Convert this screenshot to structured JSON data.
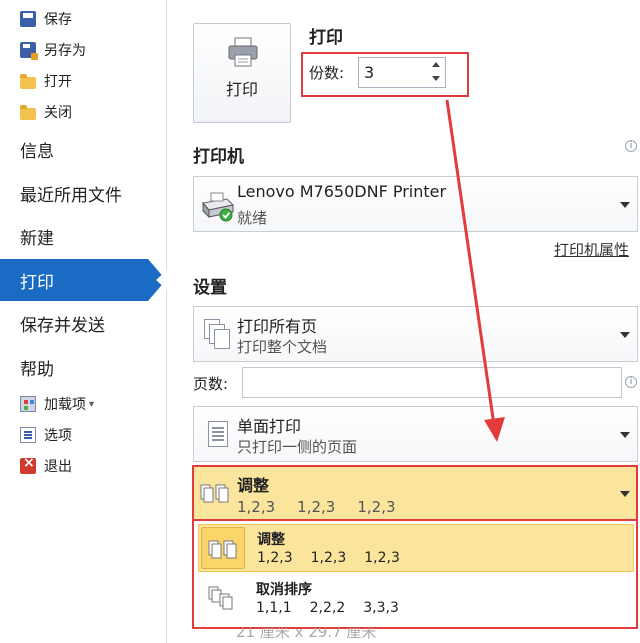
{
  "sidebar": {
    "items": [
      {
        "label": "保存",
        "icon": "save-icon"
      },
      {
        "label": "另存为",
        "icon": "save-as-icon"
      },
      {
        "label": "打开",
        "icon": "open-folder-icon"
      },
      {
        "label": "关闭",
        "icon": "close-folder-icon"
      },
      {
        "label": "信息"
      },
      {
        "label": "最近所用文件"
      },
      {
        "label": "新建"
      },
      {
        "label": "打印",
        "active": true
      },
      {
        "label": "保存并发送"
      },
      {
        "label": "帮助"
      },
      {
        "label": "加载项",
        "icon": "add-ins-icon",
        "suffix": "▾"
      },
      {
        "label": "选项",
        "icon": "options-icon"
      },
      {
        "label": "退出",
        "icon": "exit-icon"
      }
    ],
    "active_color": "#1a6bc4"
  },
  "print": {
    "heading": "打印",
    "button_label": "打印",
    "copies_label": "份数:",
    "copies_value": "3"
  },
  "printer": {
    "heading": "打印机",
    "name": "Lenovo M7650DNF Printer",
    "status": "就绪",
    "properties_link": "打印机属性"
  },
  "settings": {
    "heading": "设置",
    "range": {
      "title": "打印所有页",
      "subtitle": "打印整个文档"
    },
    "pages_label": "页数:",
    "pages_value": "",
    "sides": {
      "title": "单面打印",
      "subtitle": "只打印一侧的页面"
    },
    "collate": {
      "title": "调整",
      "sequence": [
        "1,2,3",
        "1,2,3",
        "1,2,3"
      ],
      "highlight_color": "#fbe49c",
      "options": [
        {
          "title": "调整",
          "sequence": [
            "1,2,3",
            "1,2,3",
            "1,2,3"
          ],
          "selected": true
        },
        {
          "title": "取消排序",
          "sequence": [
            "1,1,1",
            "2,2,2",
            "3,3,3"
          ],
          "selected": false
        }
      ]
    },
    "below_text": "21 厘米 x 29.7 厘米"
  },
  "annotation": {
    "color": "#e23b3b"
  }
}
